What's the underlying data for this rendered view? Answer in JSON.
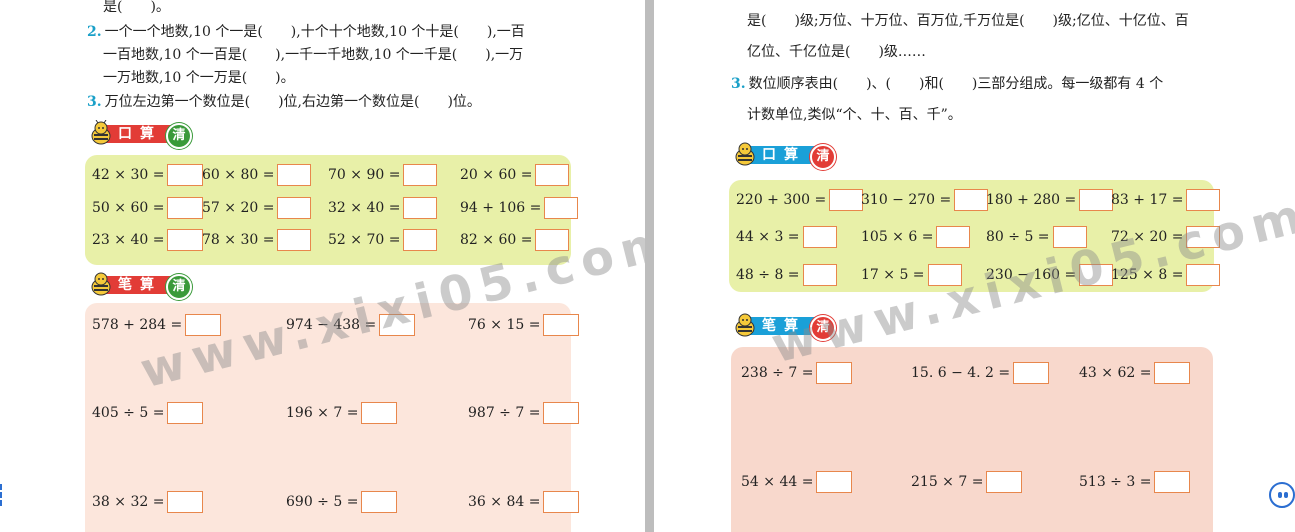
{
  "left": {
    "lines": [
      {
        "text": "是(　　)。"
      },
      {
        "num": "2.",
        "text": "一个一个地数,10 个一是(　　),十个十个地数,10 个十是(　　),一百"
      },
      {
        "text": "一百地数,10 个一百是(　　),一千一千地数,10 个一千是(　　),一万"
      },
      {
        "text": "一万地数,10 个一万是(　　)。"
      },
      {
        "num": "3.",
        "text": "万位左边第一个数位是(　　)位,右边第一个数位是(　　)位。"
      }
    ],
    "oral_label": "口算",
    "written_label": "笔算",
    "qing": "清",
    "oral": [
      "42 × 30 =",
      "60 × 80 =",
      "70 × 90 =",
      "20 × 60 =",
      "50 × 60 =",
      "57 × 20 =",
      "32 × 40 =",
      "94 + 106 =",
      "23 × 40 =",
      "78 × 30 =",
      "52 × 70 =",
      "82 × 60 ="
    ],
    "written": [
      "578 + 284 =",
      "974 − 438 =",
      "76 × 15 =",
      "405 ÷ 5 =",
      "196 × 7 =",
      "987 ÷ 7 =",
      "38 × 32 =",
      "690 ÷ 5 =",
      "36 × 84 ="
    ]
  },
  "right": {
    "lines": [
      {
        "text": "是(　　)级;万位、十万位、百万位,千万位是(　　)级;亿位、十亿位、百"
      },
      {
        "text": "亿位、千亿位是(　　)级……"
      },
      {
        "num": "3.",
        "text": "数位顺序表由(　　)、(　　)和(　　)三部分组成。每一级都有 4 个"
      },
      {
        "text": "计数单位,类似“个、十、百、千”。"
      }
    ],
    "oral_label": "口算",
    "written_label": "笔算",
    "qing": "清",
    "oral": [
      "220 + 300 =",
      "310 − 270 =",
      "180 + 280 =",
      "83 + 17 =",
      "44 × 3 =",
      "105 × 6 =",
      "80 ÷ 5 =",
      "72 × 20 =",
      "48 ÷ 8 =",
      "17 × 5 =",
      "230 − 160 =",
      "125 × 8 ="
    ],
    "written": [
      "238 ÷ 7 =",
      "15. 6 − 4. 2 =",
      "43 × 62 =",
      "54 × 44 =",
      "215 × 7 =",
      "513 ÷ 3 ="
    ]
  },
  "watermark": "www.xixi05.com"
}
